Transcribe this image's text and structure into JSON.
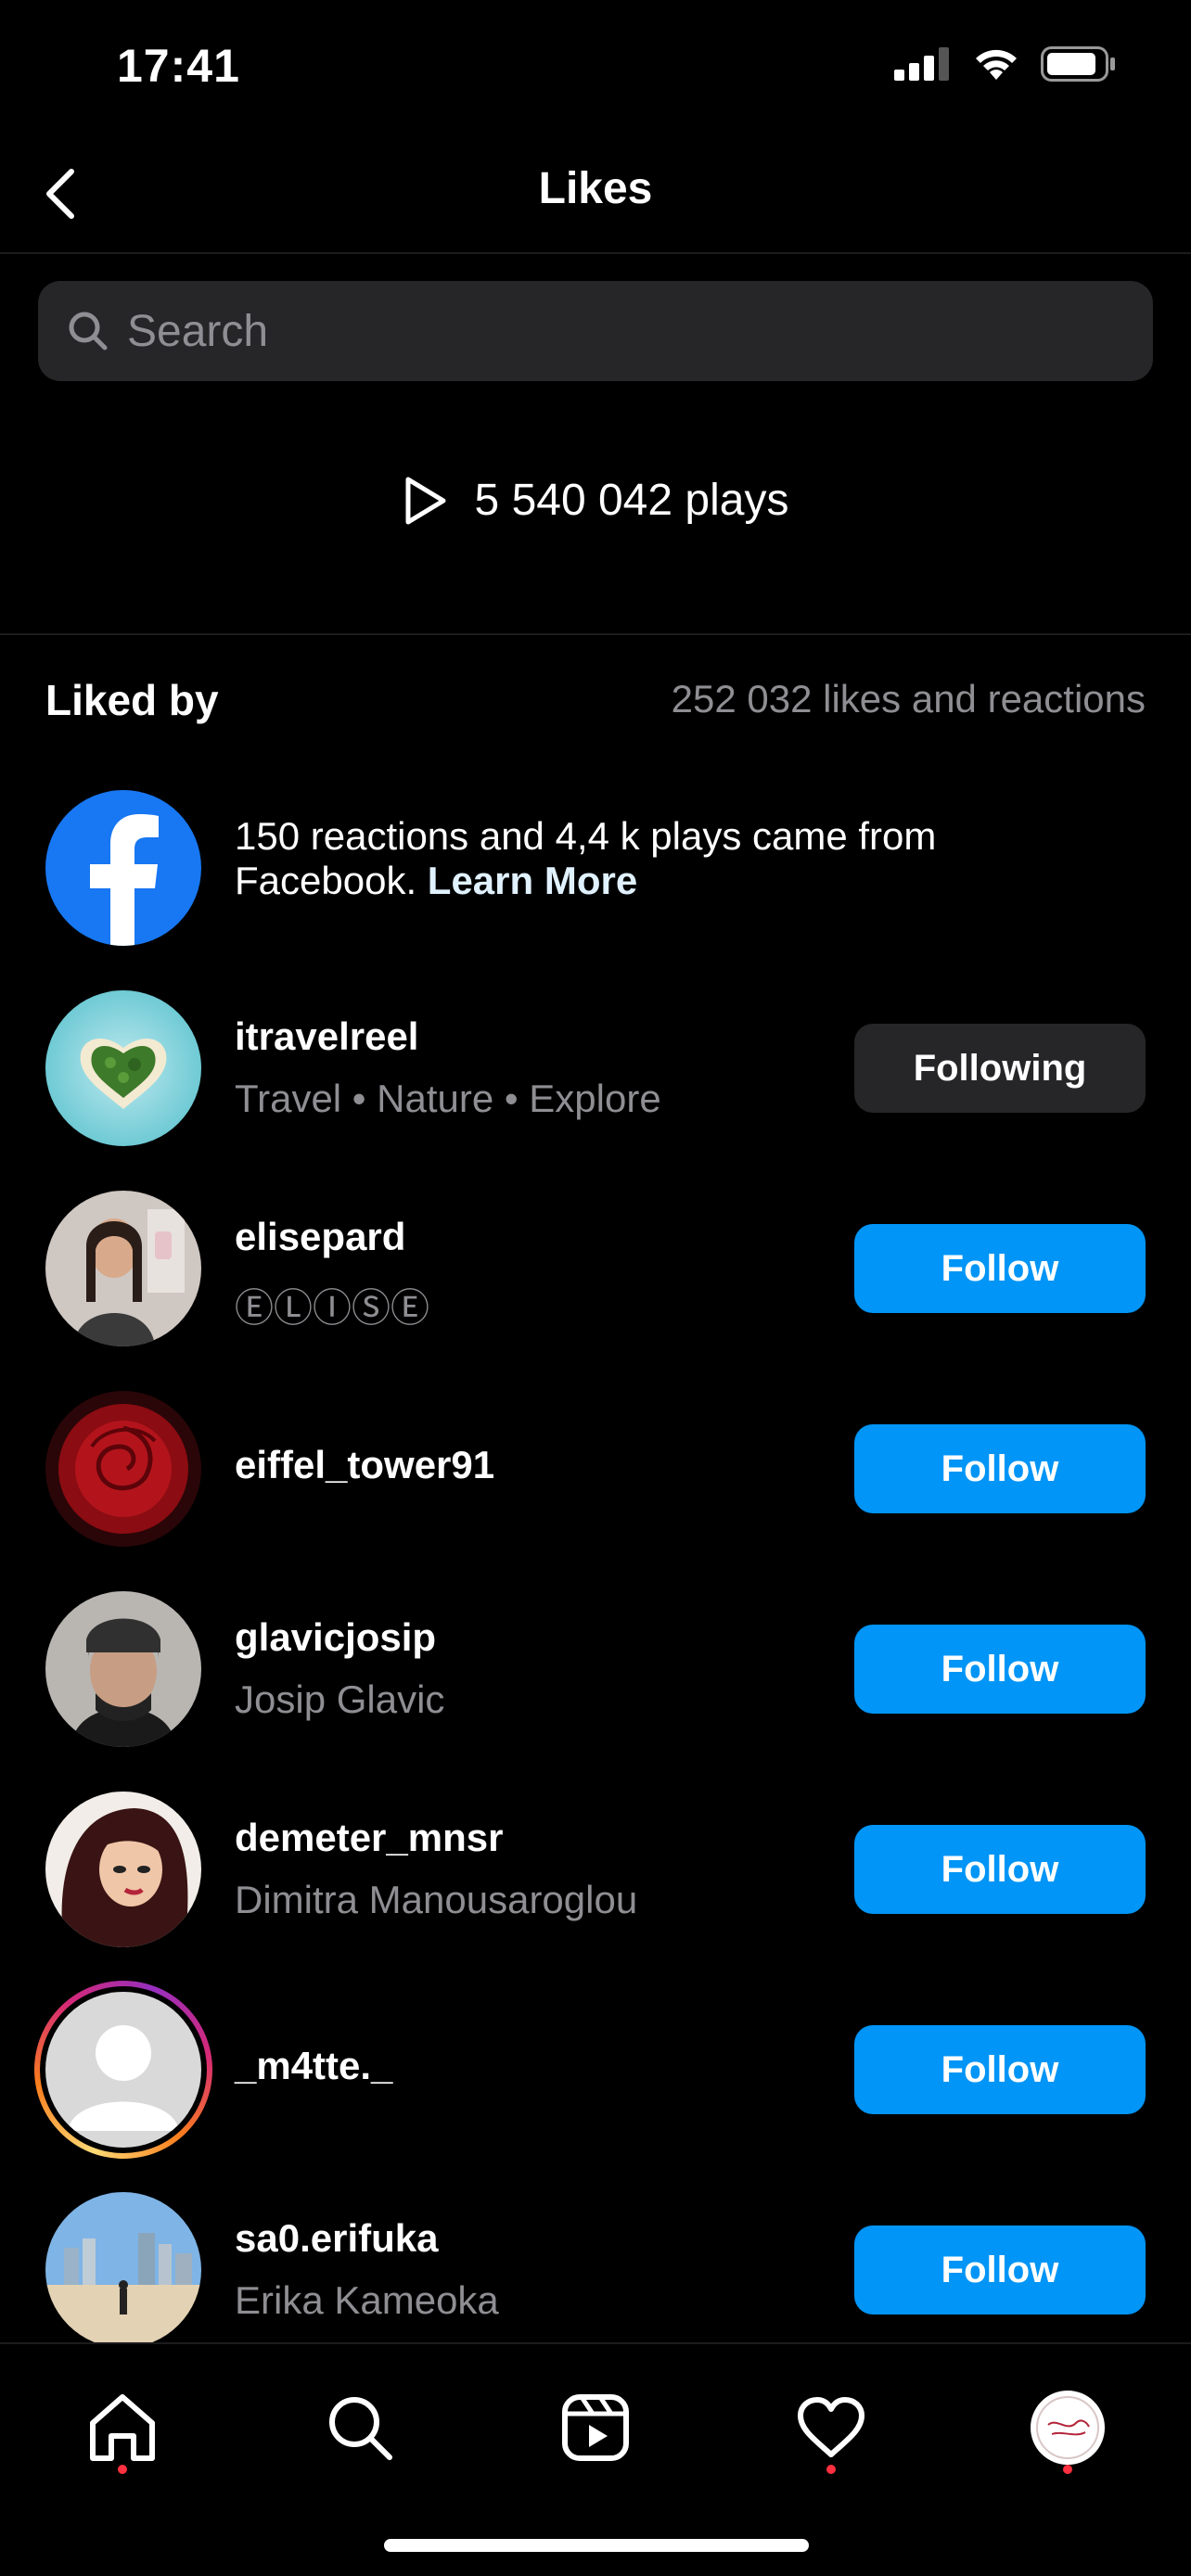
{
  "status_bar": {
    "time": "17:41"
  },
  "header": {
    "title": "Likes"
  },
  "search": {
    "placeholder": "Search"
  },
  "plays": {
    "text": "5 540 042 plays"
  },
  "liked_by": {
    "title": "Liked by",
    "count": "252 032 likes and reactions"
  },
  "facebook": {
    "text": "150 reactions and 4,4 k plays came from Facebook.",
    "link": "Learn More"
  },
  "users": [
    {
      "username": "itravelreel",
      "subtitle": "Travel • Nature • Explore",
      "button": "Following"
    },
    {
      "username": "elisepard",
      "subtitle": "ⒺⓁⒾⓈⒺ",
      "button": "Follow"
    },
    {
      "username": "eiffel_tower91",
      "subtitle": "",
      "button": "Follow"
    },
    {
      "username": "glavicjosip",
      "subtitle": "Josip Glavic",
      "button": "Follow"
    },
    {
      "username": "demeter_mnsr",
      "subtitle": "Dimitra Manousaroglou",
      "button": "Follow"
    },
    {
      "username": "_m4tte._",
      "subtitle": "",
      "button": "Follow"
    },
    {
      "username": "sa0.erifuka",
      "subtitle": "Erika Kameoka",
      "button": "Follow"
    }
  ],
  "tabbar": {
    "items": [
      "home-icon",
      "search-icon",
      "reels-icon",
      "heart-icon",
      "profile-avatar"
    ]
  },
  "colors": {
    "background": "#000000",
    "follow_button": "#0095f6",
    "following_button": "#262628",
    "muted_text": "#8e8e93",
    "notification_dot": "#ff3040"
  }
}
